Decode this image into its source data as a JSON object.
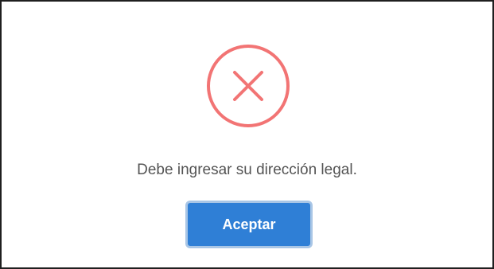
{
  "dialog": {
    "icon": "error-x-circle-icon",
    "icon_color": "#f27474",
    "message": "Debe ingresar su dirección legal.",
    "confirm_label": "Aceptar",
    "confirm_color": "#2f7fd6"
  }
}
